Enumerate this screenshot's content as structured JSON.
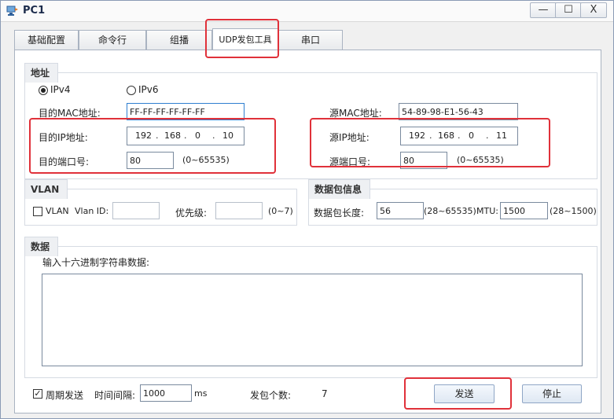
{
  "window": {
    "title": "PC1",
    "minimize_glyph": "—",
    "maximize_glyph": "☐",
    "close_glyph": "X"
  },
  "tabs": [
    {
      "label": "基础配置",
      "active": false
    },
    {
      "label": "命令行",
      "active": false
    },
    {
      "label": "组播",
      "active": false
    },
    {
      "label": "UDP发包工具",
      "active": true
    },
    {
      "label": "串口",
      "active": false
    }
  ],
  "address": {
    "group_label": "地址",
    "ipv4_label": "IPv4",
    "ipv6_label": "IPv6",
    "ipv4_selected": true,
    "dst_mac_label": "目的MAC地址:",
    "dst_mac_value": "FF-FF-FF-FF-FF-FF",
    "src_mac_label": "源MAC地址:",
    "src_mac_value": "54-89-98-E1-56-43",
    "dst_ip_label": "目的IP地址:",
    "dst_ip": [
      "192",
      "168",
      "0",
      "10"
    ],
    "src_ip_label": "源IP地址:",
    "src_ip": [
      "192",
      "168",
      "0",
      "11"
    ],
    "dst_port_label": "目的端口号:",
    "dst_port_value": "80",
    "dst_port_range": "(0~65535)",
    "src_port_label": "源端口号:",
    "src_port_value": "80",
    "src_port_range": "(0~65535)",
    "ip_dot": "."
  },
  "vlan": {
    "group_label": "VLAN",
    "checkbox_label": "VLAN",
    "checked": false,
    "vlan_id_label": "Vlan ID:",
    "vlan_id_value": "",
    "priority_label": "优先级:",
    "priority_value": "",
    "priority_range": "(0~7)"
  },
  "packet_info": {
    "group_label": "数据包信息",
    "length_label": "数据包长度:",
    "length_value": "56",
    "length_range": "(28~65535)",
    "mtu_label": "MTU:",
    "mtu_value": "1500",
    "mtu_range": "(28~1500)"
  },
  "data": {
    "group_label": "数据",
    "hex_input_label": "输入十六进制字符串数据:",
    "hex_value": ""
  },
  "footer": {
    "periodic_send_label": "周期发送",
    "periodic_checked": true,
    "check_glyph": "✓",
    "interval_label": "时间间隔:",
    "interval_value": "1000",
    "interval_unit": "ms",
    "packet_count_label": "发包个数:",
    "packet_count_value": "7",
    "send_button": "发送",
    "stop_button": "停止"
  },
  "colors": {
    "highlight": "#e0313a",
    "accent_border": "#2f7fd0"
  }
}
